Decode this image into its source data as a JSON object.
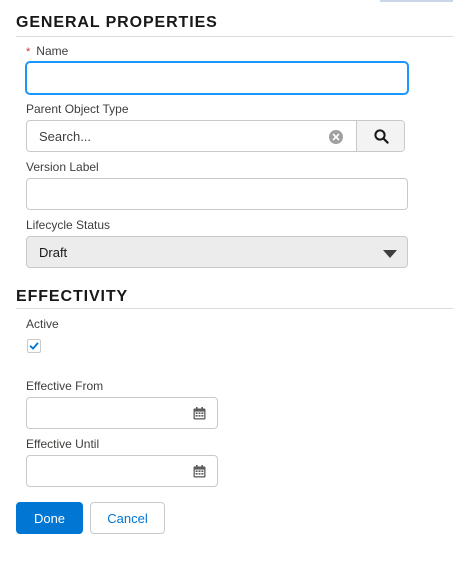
{
  "general": {
    "title": "GENERAL PROPERTIES",
    "name_label": "Name",
    "required_mark": "*",
    "name_value": "",
    "parent_type_label": "Parent Object Type",
    "parent_type_placeholder": "Search...",
    "version_label": "Version Label",
    "version_value": "",
    "lifecycle_label": "Lifecycle Status",
    "lifecycle_value": "Draft"
  },
  "effectivity": {
    "title": "EFFECTIVITY",
    "active_label": "Active",
    "active_checked": true,
    "from_label": "Effective From",
    "from_value": "",
    "until_label": "Effective Until",
    "until_value": ""
  },
  "actions": {
    "done_label": "Done",
    "cancel_label": "Cancel"
  },
  "icons": {
    "clear": "clear-icon",
    "search": "search-icon",
    "dropdown": "chevron-down-icon",
    "check": "check-icon",
    "calendar": "calendar-icon"
  },
  "colors": {
    "brand": "#0176d3",
    "focus": "#1b96ff",
    "required": "#c23934"
  }
}
